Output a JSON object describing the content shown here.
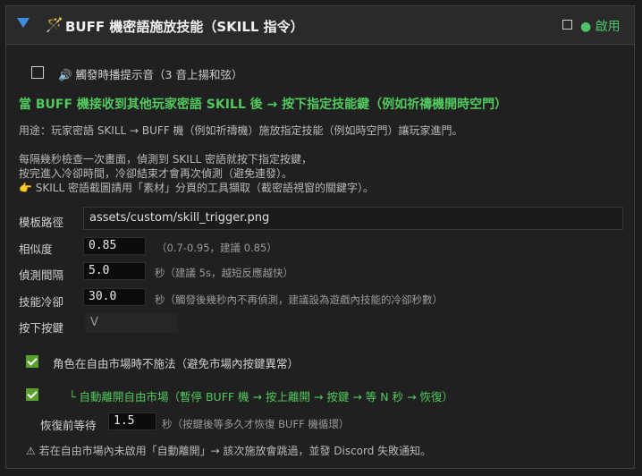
{
  "header": {
    "title": "BUFF 機密語施放技能（SKILL 指令）",
    "enable_label": "● 啟用",
    "collapse_icon": "triangle-down-icon",
    "title_icon": "magic-wand-icon"
  },
  "sound": {
    "label": "🔊 觸發時播提示音（3 音上揚和弦）"
  },
  "section_title": "當 BUFF 機接收到其他玩家密語 SKILL 後 → 按下指定技能鍵（例如祈禱機開時空門）",
  "desc": {
    "usage": "用途：玩家密語 SKILL → BUFF 機（例如祈禱機）施放指定技能（例如時空門）讓玩家進門。",
    "line1": "每隔幾秒檢查一次畫面，偵測到 SKILL 密語就按下指定按鍵，",
    "line2": "按完進入冷卻時間，冷卻結束才會再次偵測（避免連發）。",
    "line3": "👉 SKILL 密語截圖請用「素材」分頁的工具擷取（截密語視窗的關鍵字）。"
  },
  "fields": {
    "template_label": "模板路徑",
    "template_value": "assets/custom/skill_trigger.png",
    "similarity_label": "相似度",
    "similarity_value": "0.85",
    "similarity_hint": "（0.7-0.95，建議 0.85）",
    "interval_label": "偵測間隔",
    "interval_value": "5.0",
    "interval_hint": "秒（建議 5s，越短反應越快）",
    "cooldown_label": "技能冷卻",
    "cooldown_value": "30.0",
    "cooldown_hint": "秒（觸發後幾秒內不再偵測，建議設為遊戲內技能的冷卻秒數）",
    "key_label": "按下按鍵",
    "key_value": "V"
  },
  "market": {
    "no_cast_label": "角色在自由市場時不施法（避免市場內按鍵異常）",
    "auto_leave_label": "└ 自動離開自由市場（暫停 BUFF 機 → 按上離開 → 按鍵 → 等 N 秒 → 恢復）",
    "wait_label": "恢復前等待",
    "wait_value": "1.5",
    "wait_hint": "秒（按鍵後等多久才恢復 BUFF 機循環）"
  },
  "warning": "⚠ 若在自由市場內未啟用「自動離開」→ 該次施放會跳過，並發 Discord 失敗通知。",
  "colors": {
    "accent_green": "#52c95f",
    "accent_blue": "#3d8bdb",
    "checkbox_green": "#5aa02f"
  }
}
